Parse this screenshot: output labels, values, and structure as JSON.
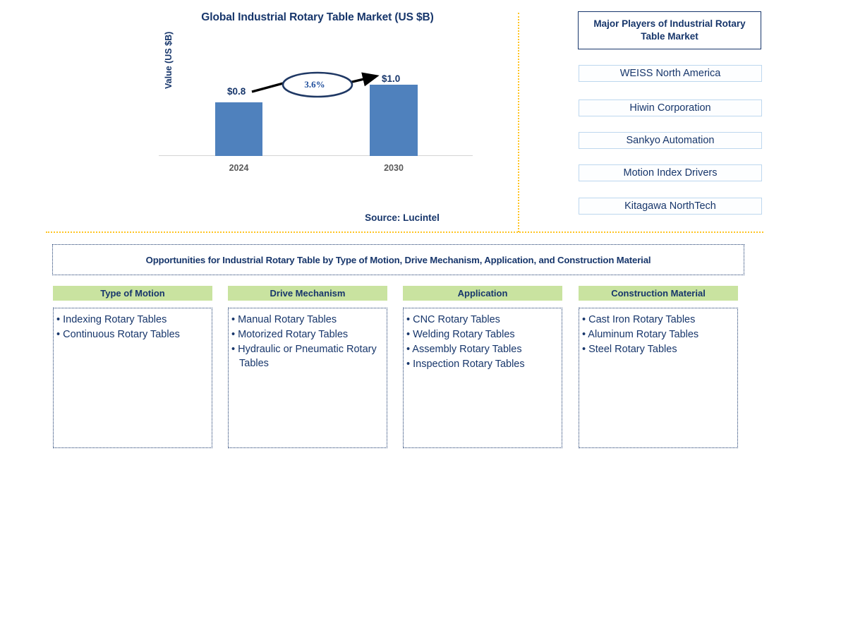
{
  "chart_data": {
    "type": "bar",
    "title": "Global Industrial Rotary Table Market (US $B)",
    "xlabel": "",
    "ylabel": "Value (US $B)",
    "categories": [
      "2024",
      "2030"
    ],
    "values": [
      0.8,
      1.0
    ],
    "value_labels": [
      "$0.8",
      "$1.0"
    ],
    "ylim": [
      0,
      1.15
    ],
    "grid": false,
    "legend": "none",
    "bar_color": "#4F81BD",
    "annotation": {
      "cagr_label": "3.6%",
      "shape": "ellipse-with-arrow",
      "from_category": "2024",
      "to_category": "2030"
    }
  },
  "chart_panel": {
    "source_note": "Source: Lucintel"
  },
  "players_panel": {
    "header": "Major Players of Industrial Rotary Table Market",
    "items": [
      "WEISS North America",
      "Hiwin Corporation",
      "Sankyo Automation",
      "Motion Index Drivers",
      "Kitagawa NorthTech"
    ]
  },
  "opportunities": {
    "banner": "Opportunities for Industrial Rotary Table by Type of Motion, Drive Mechanism, Application, and Construction Material",
    "columns": [
      {
        "header": "Type of Motion",
        "items": [
          "Indexing Rotary Tables",
          "Continuous Rotary Tables"
        ]
      },
      {
        "header": "Drive Mechanism",
        "items": [
          "Manual Rotary Tables",
          "Motorized Rotary Tables",
          "Hydraulic or Pneumatic Rotary Tables"
        ]
      },
      {
        "header": "Application",
        "items": [
          "CNC Rotary Tables",
          "Welding Rotary Tables",
          "Assembly Rotary Tables",
          "Inspection Rotary Tables"
        ]
      },
      {
        "header": "Construction Material",
        "items": [
          "Cast Iron Rotary Tables",
          "Aluminum Rotary Tables",
          "Steel Rotary Tables"
        ]
      }
    ]
  },
  "theme": {
    "navy": "#17366B",
    "bar_blue": "#4F81BD",
    "gold": "#FFC423",
    "green": "#C9E3A0",
    "light_blue_border": "#BDD7EE"
  }
}
